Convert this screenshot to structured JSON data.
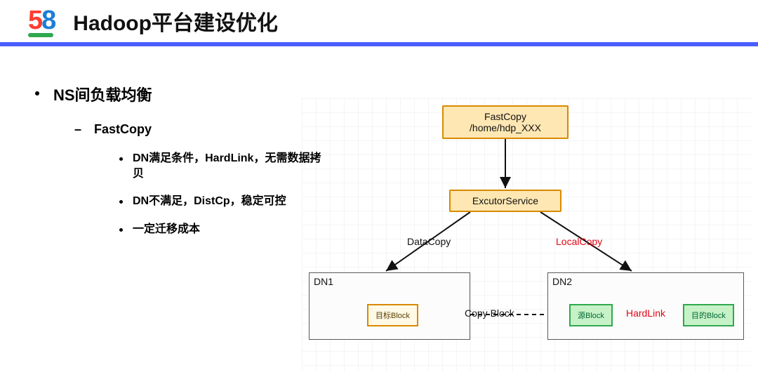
{
  "header": {
    "logo_5": "5",
    "logo_8": "8",
    "title": "Hadoop平台建设优化"
  },
  "bullets": {
    "l1": "NS间负载均衡",
    "l2": "FastCopy",
    "l3a": "DN满足条件，HardLink，无需数据拷贝",
    "l3b": "DN不满足，DistCp，稳定可控",
    "l3c": "一定迁移成本"
  },
  "diagram": {
    "fastcopy_line1": "FastCopy",
    "fastcopy_line2": "/home/hdp_XXX",
    "executor": "ExcutorService",
    "datacopy_label": "DataCopy",
    "localcopy_label": "LocalCopy",
    "dn1_label": "DN1",
    "dn2_label": "DN2",
    "target_block": "目标Block",
    "source_block": "源Block",
    "dest_block": "目的Block",
    "copy_block": "Copy Block",
    "hardlink": "HardLink"
  }
}
